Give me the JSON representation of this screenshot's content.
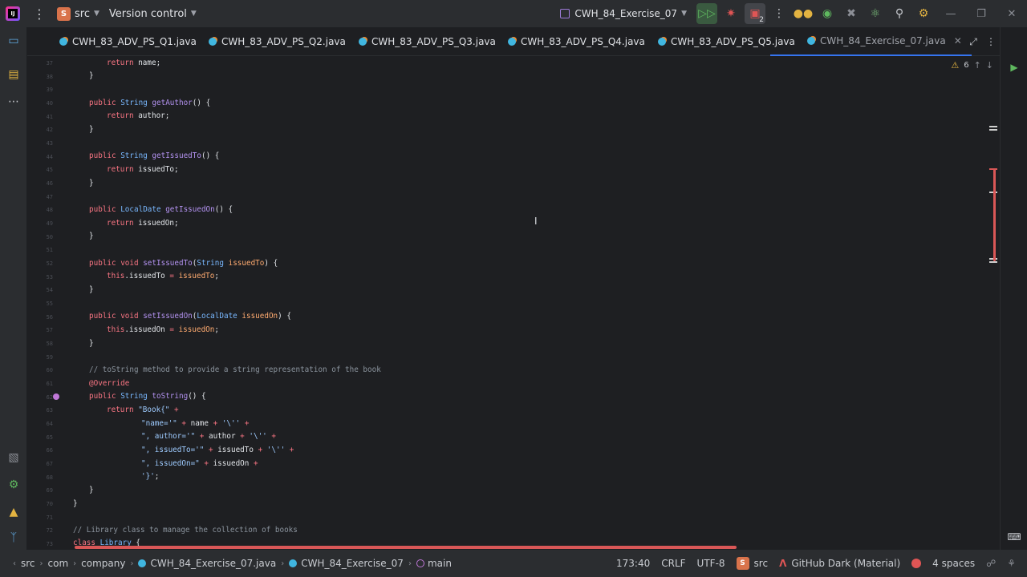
{
  "titlebar": {
    "project_badge": "S",
    "project_name": "src",
    "vcs_label": "Version control",
    "run_config": "CWH_84_Exercise_07",
    "stop_count": "2"
  },
  "tabs": [
    {
      "label": "CWH_83_ADV_PS_Q1.java"
    },
    {
      "label": "CWH_83_ADV_PS_Q2.java"
    },
    {
      "label": "CWH_83_ADV_PS_Q3.java"
    },
    {
      "label": "CWH_83_ADV_PS_Q4.java"
    },
    {
      "label": "CWH_83_ADV_PS_Q5.java"
    },
    {
      "label": "CWH_84_Exercise_07.java",
      "active": true
    }
  ],
  "inspections": {
    "warnings": "6"
  },
  "statusbar": {
    "crumbs": [
      "src",
      "com",
      "company",
      "CWH_84_Exercise_07.java",
      "CWH_84_Exercise_07",
      "main"
    ],
    "position": "173:40",
    "line_sep": "CRLF",
    "encoding": "UTF-8",
    "module_badge": "S",
    "module": "src",
    "theme": "GitHub Dark (Material)",
    "indent": "4 spaces"
  },
  "code": {
    "l1": "return",
    "l1b": " name;",
    "c_tostring": "// toString method to provide a string representation of the book",
    "ann_override": "@Override",
    "c_library": "// Library class to manage the collection of books",
    "cut_line": "class Library {"
  }
}
